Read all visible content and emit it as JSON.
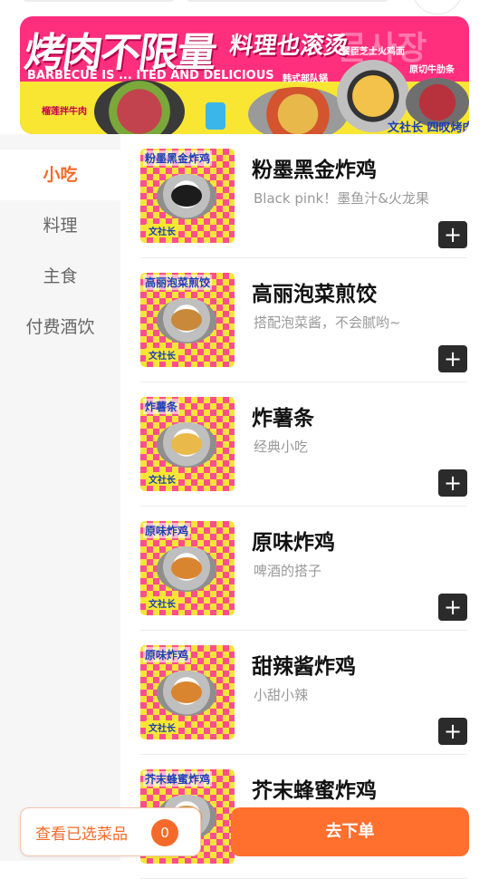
{
  "banner": {
    "title": "烤肉不限量",
    "title2": "料理也滚烫",
    "korean": "문사장",
    "subtitle": "BARBECUE IS ... ITED AND DELICIOUS",
    "label_left": "榴莲拌牛肉",
    "label_mid": "韩式部队锅",
    "label_top": "餐臣芝士火鸡面",
    "label_right": "原切牛肋条",
    "brand": "文社长 四叹烤肉食堂"
  },
  "sidebar": {
    "categories": [
      {
        "label": "小吃",
        "active": true
      },
      {
        "label": "料理",
        "active": false
      },
      {
        "label": "主食",
        "active": false
      },
      {
        "label": "付费酒饮",
        "active": false
      }
    ]
  },
  "items": [
    {
      "name": "粉墨黑金炸鸡",
      "desc": "Black pink！墨鱼汁&火龙果",
      "thumb_label": "粉墨黑金炸鸡",
      "food_color": "#1c1c1c"
    },
    {
      "name": "高丽泡菜煎饺",
      "desc": "搭配泡菜酱，不会腻哟~",
      "thumb_label": "高丽泡菜煎饺",
      "food_color": "#c9893a"
    },
    {
      "name": "炸薯条",
      "desc": "经典小吃",
      "thumb_label": "炸薯条",
      "food_color": "#e9b94a"
    },
    {
      "name": "原味炸鸡",
      "desc": "啤酒的搭子",
      "thumb_label": "原味炸鸡",
      "food_color": "#d9852f"
    },
    {
      "name": "甜辣酱炸鸡",
      "desc": "小甜小辣",
      "thumb_label": "原味炸鸡",
      "food_color": "#d9852f"
    },
    {
      "name": "芥末蜂蜜炸鸡",
      "desc": "",
      "thumb_label": "芥末蜂蜜炸鸡",
      "food_color": "#caa34a"
    }
  ],
  "add_symbol": "+",
  "thumb_brand": "文社长",
  "footer": {
    "view_selected": "查看已选菜品",
    "count": "0",
    "order": "去下单"
  },
  "colors": {
    "accent": "#f56a2b",
    "order_button": "#ff6f2e",
    "banner_pink": "#ff2f7d",
    "banner_yellow": "#f8e633"
  }
}
